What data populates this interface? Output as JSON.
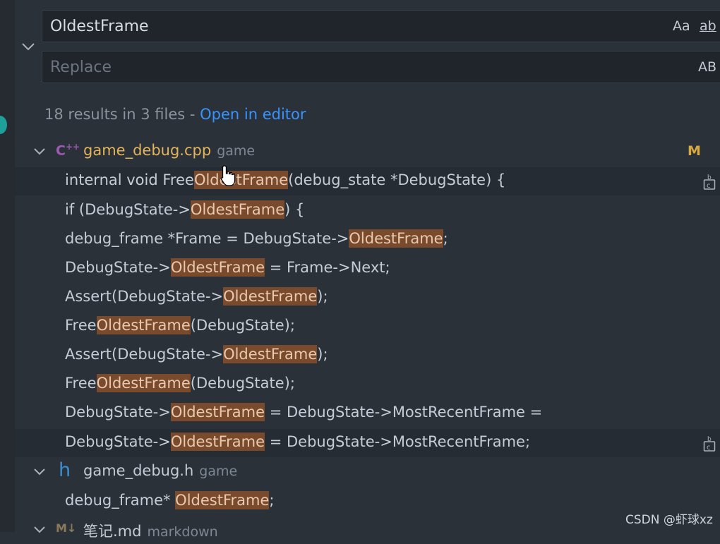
{
  "search": {
    "find_value": "OldestFrame",
    "replace_placeholder": "Replace",
    "match_case_label": "Aa",
    "whole_word_label": "ab",
    "preserve_case_label": "AB"
  },
  "summary": {
    "text": "18 results in 3 files - ",
    "link": "Open in editor"
  },
  "files": [
    {
      "name": "game_debug.cpp",
      "dir": "game",
      "icon": "C++ file icon",
      "badge": "M",
      "matches": [
        {
          "pre": "internal void Free",
          "match": "OldestFrame",
          "post": "(debug_state *DebugState) {"
        },
        {
          "pre": "if (DebugState->",
          "match": "OldestFrame",
          "post": ") {"
        },
        {
          "pre": "debug_frame *Frame = DebugState->",
          "match": "OldestFrame",
          "post": ";"
        },
        {
          "pre": "DebugState->",
          "match": "OldestFrame",
          "post": " = Frame->Next;"
        },
        {
          "pre": "Assert(DebugState->",
          "match": "OldestFrame",
          "post": ");"
        },
        {
          "pre": "Free",
          "match": "OldestFrame",
          "post": "(DebugState);"
        },
        {
          "pre": "Assert(DebugState->",
          "match": "OldestFrame",
          "post": ");"
        },
        {
          "pre": "Free",
          "match": "OldestFrame",
          "post": "(DebugState);"
        },
        {
          "pre": "DebugState->",
          "match": "OldestFrame",
          "post": " = DebugState->MostRecentFrame ="
        },
        {
          "pre": "DebugState->",
          "match": "OldestFrame",
          "post": " = DebugState->MostRecentFrame;"
        }
      ]
    },
    {
      "name": "game_debug.h",
      "dir": "game",
      "icon": "h",
      "matches": [
        {
          "pre": "debug_frame* ",
          "match": "OldestFrame",
          "post": ";"
        }
      ]
    },
    {
      "name": "笔记.md",
      "dir": "markdown",
      "icon": "M↓"
    }
  ],
  "watermark": "CSDN @虾球xz",
  "colors": {
    "background": "#2b3138",
    "match_highlight": "#7a4a2c",
    "link": "#3794ff",
    "cpp_filename": "#e4b45a",
    "modified_badge": "#d9a93f"
  }
}
